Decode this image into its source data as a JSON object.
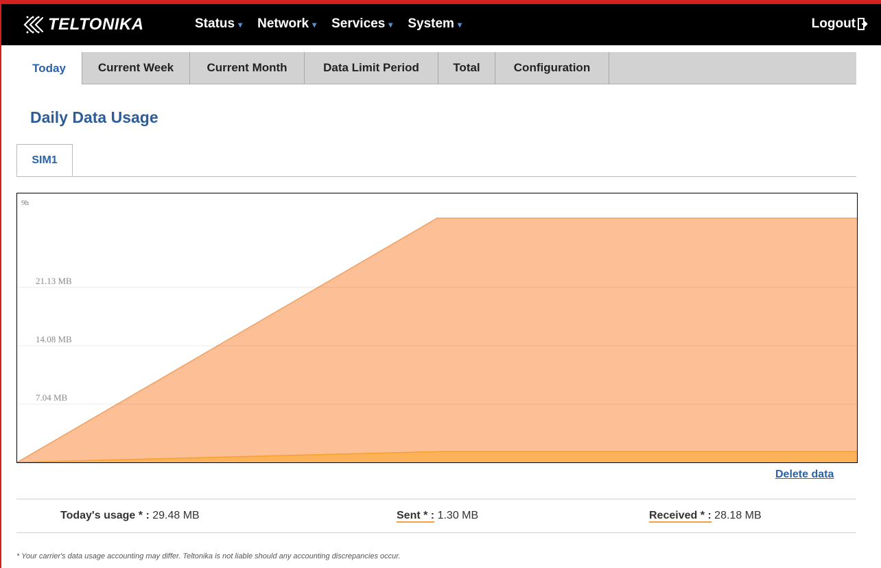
{
  "header": {
    "brand": "TELTONIKA",
    "nav": [
      {
        "label": "Status"
      },
      {
        "label": "Network"
      },
      {
        "label": "Services"
      },
      {
        "label": "System"
      }
    ],
    "logout_label": "Logout"
  },
  "tabs": [
    {
      "label": "Today",
      "active": true
    },
    {
      "label": "Current Week"
    },
    {
      "label": "Current Month"
    },
    {
      "label": "Data Limit Period"
    },
    {
      "label": "Total"
    },
    {
      "label": "Configuration"
    }
  ],
  "page_title": "Daily Data Usage",
  "sim_tab": "SIM1",
  "chart_data": {
    "type": "area",
    "x_axis_label": "9h",
    "y_ticks": [
      "7.04 MB",
      "14.08 MB",
      "21.13 MB"
    ],
    "y_tick_values": [
      7.04,
      14.08,
      21.13
    ],
    "ylim": [
      0,
      29.48
    ],
    "grid": true,
    "series": [
      {
        "values": [
          0,
          29.48,
          29.48
        ],
        "color": "#fdbf96"
      },
      {
        "values": [
          0,
          1.3,
          1.3
        ],
        "color": "#fcb258"
      }
    ],
    "x": [
      0,
      0.5,
      1
    ]
  },
  "delete_label": "Delete data",
  "stats": {
    "today_label": "Today's usage * :",
    "today_value": "29.48 MB",
    "sent_label": "Sent * :",
    "sent_value": "1.30 MB",
    "received_label": "Received * :",
    "received_value": "28.18 MB"
  },
  "footnote": "* Your carrier's data usage accounting may differ. Teltonika is not liable should any accounting discrepancies occur.",
  "colors": {
    "accent_blue": "#2a63a8",
    "frame_red": "#d21f1f",
    "area_fill": "#fdbf96",
    "area_line": "#f0a060",
    "sent_fill": "#fcb258"
  }
}
